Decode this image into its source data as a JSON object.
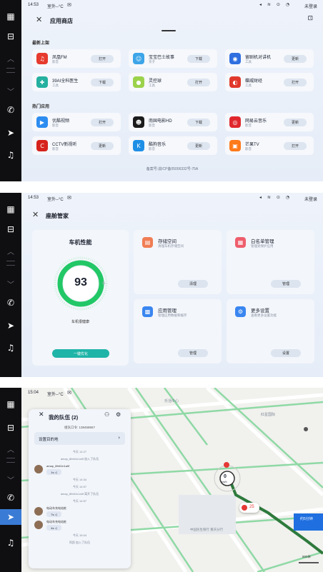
{
  "status": {
    "time1": "14:53",
    "time3": "15:04",
    "weather": "室外--°C",
    "user": "未登录"
  },
  "dock": {
    "icons": [
      "apps-grid-icon",
      "seat-icon",
      "fan-up-icon",
      "temp-divider",
      "fan-down-icon",
      "phone-icon",
      "navigation-icon",
      "music-icon"
    ]
  },
  "appstore": {
    "title": "应用商店",
    "section_new": "最新上架",
    "section_hot": "热门应用",
    "new_apps": [
      {
        "name": "凤凰FM",
        "category": "影音",
        "button": "打开",
        "color": "#e63b2e",
        "glyph": "♫"
      },
      {
        "name": "宝宝巴士故事",
        "category": "亲子",
        "button": "下载",
        "color": "#3da5e8",
        "glyph": "☺"
      },
      {
        "name": "留剧机对讲机",
        "category": "工具",
        "button": "更新",
        "color": "#2f6fe0",
        "glyph": "◉"
      },
      {
        "name": "39AI全科医生",
        "category": "工具",
        "button": "下载",
        "color": "#25b0a0",
        "glyph": "✚"
      },
      {
        "name": "灵控球",
        "category": "工具",
        "button": "打开",
        "color": "#9bd24b",
        "glyph": "●"
      },
      {
        "name": "蝶威财经",
        "category": "工具",
        "button": "打开",
        "color": "#e0392b",
        "glyph": "◐"
      }
    ],
    "hot_apps": [
      {
        "name": "优酷视频",
        "category": "影音",
        "button": "打开",
        "color": "#2d8cf0",
        "glyph": "▶"
      },
      {
        "name": "南国电影HD",
        "category": "影音",
        "button": "下载",
        "color": "#1b1b1b",
        "glyph": "☻"
      },
      {
        "name": "网易云音乐",
        "category": "影音",
        "button": "更新",
        "color": "#e0272d",
        "glyph": "◎"
      },
      {
        "name": "CCTV新视听",
        "category": "影音",
        "button": "更新",
        "color": "#d6231c",
        "glyph": "C"
      },
      {
        "name": "酷狗音乐",
        "category": "影音",
        "button": "更新",
        "color": "#1f8fe6",
        "glyph": "K"
      },
      {
        "name": "芒果TV",
        "category": "影音",
        "button": "打开",
        "color": "#ff7a1a",
        "glyph": "▣"
      }
    ],
    "footer": "备案号:渝ICP备05006332号-75A"
  },
  "butler": {
    "title": "座舱管家",
    "perf_title": "车机性能",
    "score": "93",
    "score_label": "车机很健康",
    "optimize": "一键优化",
    "cards": [
      {
        "title": "存储空间",
        "sub": "清理车机存储空间",
        "button": "清理",
        "color": "#f07d54",
        "glyph": "▤"
      },
      {
        "title": "白名单管理",
        "sub": "管理受保护应用",
        "button": "管理",
        "color": "#ee5e6c",
        "glyph": "▦"
      },
      {
        "title": "应用管理",
        "sub": "管理应用数据和缓存",
        "button": "管理",
        "color": "#3a86f0",
        "glyph": "▩"
      },
      {
        "title": "更多设置",
        "sub": "查看更多设置功能",
        "button": "设置",
        "color": "#3a86f0",
        "glyph": "⚙"
      }
    ]
  },
  "team": {
    "title": "我的队伍 (2)",
    "code_label": "组队口令: 13845865?",
    "set_destination": "设置目的地",
    "messages": [
      {
        "time": "今天 14:27"
      },
      {
        "notice": "amap_8fe61n1a0f 加入了队伍"
      },
      {
        "name": "amap_8fe61n1a0f",
        "bubble": "1s ◁"
      },
      {
        "time": "今天 14:34"
      },
      {
        "time": "今天 14:57"
      },
      {
        "notice": "amap_8fe61n1a0f 离开了队伍"
      },
      {
        "time": "今天 14:57"
      },
      {
        "name": "电动车充电站桩",
        "bubble": "7s ◁"
      },
      {
        "name": "电动车充电站桩",
        "bubble": "4s ◁"
      },
      {
        "time": "今天 15:04"
      },
      {
        "notice": "阿凯 加入了队伍"
      }
    ],
    "map_labels": [
      "乐活中心",
      "红星国际",
      "中国民生银行 重庆分行",
      "0",
      "km/h",
      "25",
      "800米"
    ],
    "route_info": "约5分钟"
  }
}
